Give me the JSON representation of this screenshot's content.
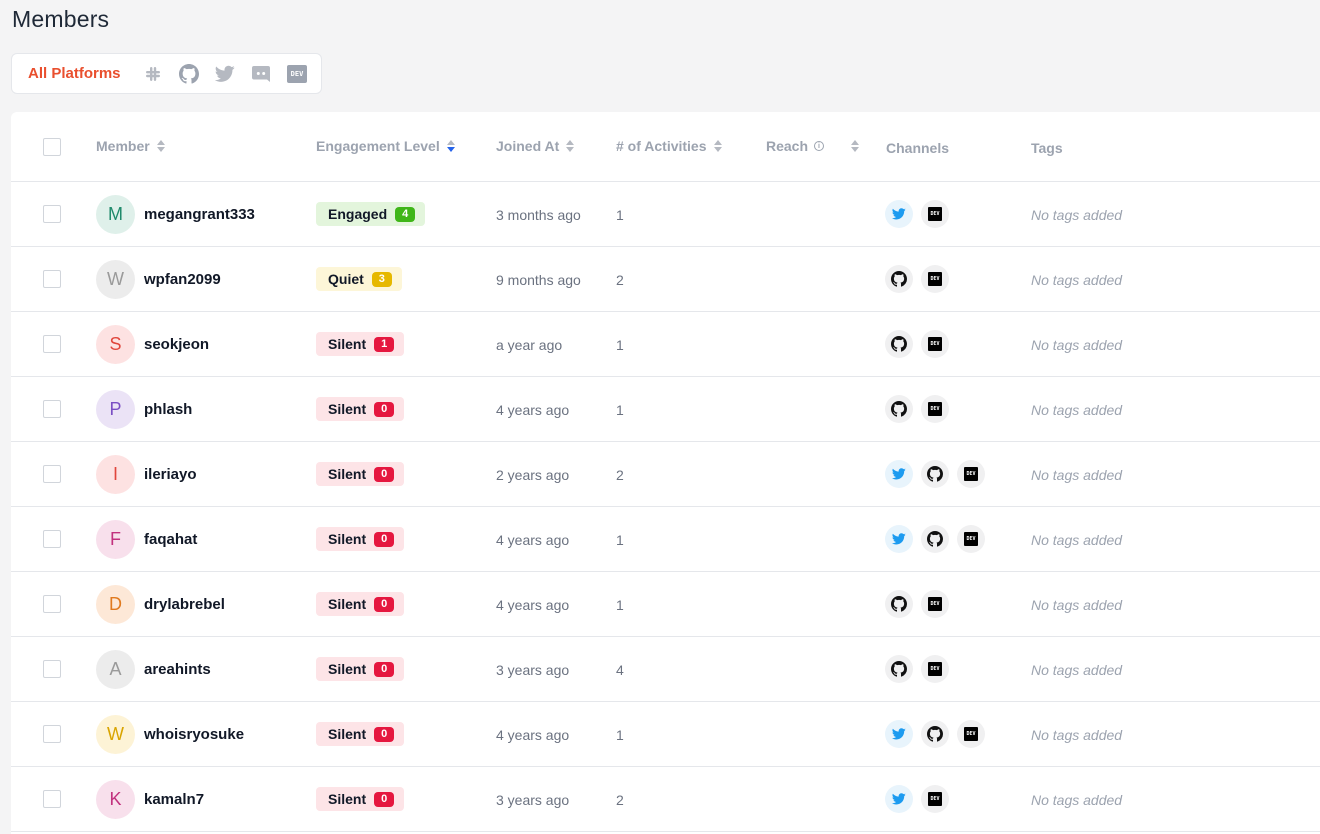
{
  "page": {
    "title": "Members"
  },
  "platforms": {
    "all_label": "All Platforms",
    "icons": [
      "slack-icon",
      "github-icon",
      "twitter-icon",
      "discord-icon",
      "dev-icon"
    ],
    "dev_label": "DEV"
  },
  "table": {
    "columns": {
      "member": "Member",
      "engagement": "Engagement Level",
      "joined": "Joined At",
      "activities": "# of Activities",
      "reach": "Reach",
      "channels": "Channels",
      "tags": "Tags"
    },
    "rows": [
      {
        "initial": "M",
        "name": "megangrant333",
        "engagement": "Engaged",
        "score": "4",
        "joined": "3 months ago",
        "activities": "1",
        "channels": [
          "twitter",
          "dev"
        ],
        "tags": "No tags added"
      },
      {
        "initial": "W",
        "name": "wpfan2099",
        "engagement": "Quiet",
        "score": "3",
        "joined": "9 months ago",
        "activities": "2",
        "channels": [
          "github",
          "dev"
        ],
        "tags": "No tags added"
      },
      {
        "initial": "S",
        "name": "seokjeon",
        "engagement": "Silent",
        "score": "1",
        "joined": "a year ago",
        "activities": "1",
        "channels": [
          "github",
          "dev"
        ],
        "tags": "No tags added"
      },
      {
        "initial": "P",
        "name": "phlash",
        "engagement": "Silent",
        "score": "0",
        "joined": "4 years ago",
        "activities": "1",
        "channels": [
          "github",
          "dev"
        ],
        "tags": "No tags added"
      },
      {
        "initial": "I",
        "name": "ileriayo",
        "engagement": "Silent",
        "score": "0",
        "joined": "2 years ago",
        "activities": "2",
        "channels": [
          "twitter",
          "github",
          "dev"
        ],
        "tags": "No tags added"
      },
      {
        "initial": "F",
        "name": "faqahat",
        "engagement": "Silent",
        "score": "0",
        "joined": "4 years ago",
        "activities": "1",
        "channels": [
          "twitter",
          "github",
          "dev"
        ],
        "tags": "No tags added"
      },
      {
        "initial": "D",
        "name": "drylabrebel",
        "engagement": "Silent",
        "score": "0",
        "joined": "4 years ago",
        "activities": "1",
        "channels": [
          "github",
          "dev"
        ],
        "tags": "No tags added"
      },
      {
        "initial": "A",
        "name": "areahints",
        "engagement": "Silent",
        "score": "0",
        "joined": "3 years ago",
        "activities": "4",
        "channels": [
          "github",
          "dev"
        ],
        "tags": "No tags added"
      },
      {
        "initial": "W",
        "name": "whoisryosuke",
        "engagement": "Silent",
        "score": "0",
        "joined": "4 years ago",
        "activities": "1",
        "channels": [
          "twitter",
          "github",
          "dev"
        ],
        "tags": "No tags added"
      },
      {
        "initial": "K",
        "name": "kamaln7",
        "engagement": "Silent",
        "score": "0",
        "joined": "3 years ago",
        "activities": "2",
        "channels": [
          "twitter",
          "dev"
        ],
        "tags": "No tags added"
      }
    ]
  },
  "colors": {
    "accent": "#e94f2e",
    "engaged_bg": "#e3f5dc",
    "engaged_badge": "#3fb618",
    "quiet_bg": "#fdf6d8",
    "quiet_badge": "#e6b800",
    "silent_bg": "#fde4e7",
    "silent_badge": "#e5173f",
    "twitter": "#1d9bf0"
  },
  "avatar_colors": [
    {
      "bg": "#dff0ea",
      "fg": "#1f8a6b"
    },
    {
      "bg": "#ececec",
      "fg": "#9a9a9a"
    },
    {
      "bg": "#fde2e2",
      "fg": "#e0463c"
    },
    {
      "bg": "#ebe3f6",
      "fg": "#7a4fc4"
    },
    {
      "bg": "#fde2e2",
      "fg": "#e0463c"
    },
    {
      "bg": "#f8e0ec",
      "fg": "#c2317e"
    },
    {
      "bg": "#fde8d7",
      "fg": "#e07a1f"
    },
    {
      "bg": "#ececec",
      "fg": "#9a9a9a"
    },
    {
      "bg": "#fdf3d6",
      "fg": "#d9a400"
    },
    {
      "bg": "#f8e0ec",
      "fg": "#c2317e"
    }
  ]
}
